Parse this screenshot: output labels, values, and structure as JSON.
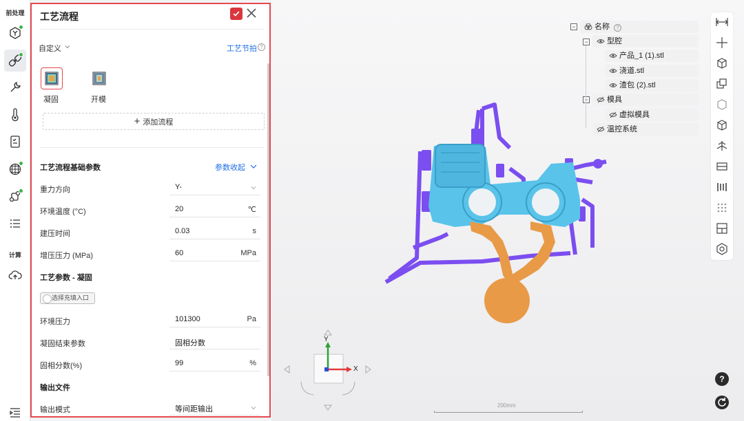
{
  "left_toolbar": {
    "pre_label": "前处理",
    "calc_label": "计算"
  },
  "panel": {
    "title": "工艺流程",
    "template_select": "自定义",
    "process_snapshot_link": "工艺节拍",
    "steps": [
      {
        "label": "凝固"
      },
      {
        "label": "开模"
      }
    ],
    "add_process": "添加流程",
    "basic_params": {
      "title": "工艺流程基础参数",
      "collapse_link": "参数收起",
      "rows": [
        {
          "label": "重力方向",
          "value": "Y-",
          "unit": ""
        },
        {
          "label": "环境温度 (°C)",
          "value": "20",
          "unit": "℃"
        },
        {
          "label": "建压时间",
          "value": "0.03",
          "unit": "s"
        },
        {
          "label": "增压压力 (MPa)",
          "value": "60",
          "unit": "MPa"
        }
      ]
    },
    "solid_params": {
      "title": "工艺参数 - 凝固",
      "toggle_label": "选择充填入口",
      "rows": [
        {
          "label": "环境压力",
          "value": "101300",
          "unit": "Pa"
        },
        {
          "label": "凝固结束参数",
          "value": "固相分数",
          "unit": ""
        },
        {
          "label": "固相分数(%)",
          "value": "99",
          "unit": "%"
        }
      ]
    },
    "output": {
      "title": "输出文件",
      "rows": [
        {
          "label": "输出模式",
          "value": "等间距输出",
          "unit": ""
        }
      ]
    }
  },
  "tree": {
    "root": "名称",
    "nodes": [
      {
        "label": "型腔"
      },
      {
        "label": "产品_1 (1).stl"
      },
      {
        "label": "浇道.stl"
      },
      {
        "label": "渣包 (2).stl"
      },
      {
        "label": "模具"
      },
      {
        "label": "虚拟模具"
      },
      {
        "label": "温控系统"
      }
    ]
  },
  "viewport": {
    "scale_label": "200mm",
    "axis_x": "X",
    "axis_y": "Y"
  },
  "colors": {
    "accent_red": "#e5484d",
    "link_blue": "#1f6fe5",
    "part_cyan": "#59c3ea",
    "runner_purple": "#7b4ef0",
    "overflow_orange": "#e89a47",
    "status_green": "#3bb54a"
  }
}
